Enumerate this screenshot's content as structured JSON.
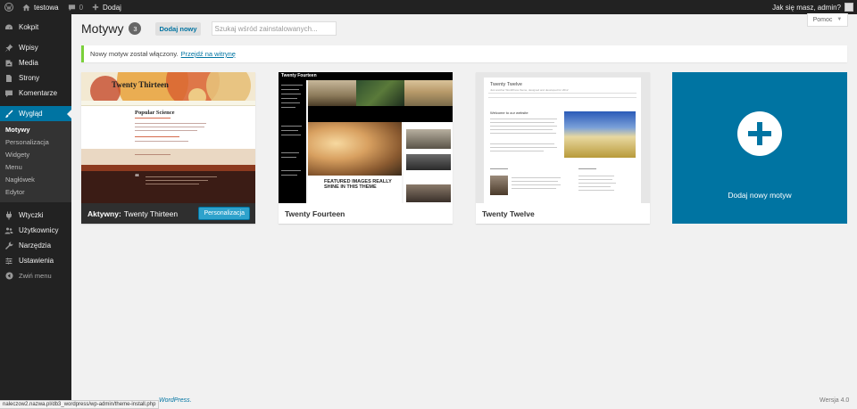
{
  "admin_bar": {
    "site_name": "testowa",
    "comments_count": "0",
    "new_label": "Dodaj",
    "howdy": "Jak się masz, admin?"
  },
  "sidebar": {
    "items": [
      {
        "label": "Kokpit",
        "icon": "dashboard-icon"
      },
      {
        "label": "Wpisy",
        "icon": "pin-icon"
      },
      {
        "label": "Media",
        "icon": "media-icon"
      },
      {
        "label": "Strony",
        "icon": "page-icon"
      },
      {
        "label": "Komentarze",
        "icon": "comment-icon"
      },
      {
        "label": "Wygląd",
        "icon": "paintbrush-icon"
      },
      {
        "label": "Wtyczki",
        "icon": "plugin-icon"
      },
      {
        "label": "Użytkownicy",
        "icon": "users-icon"
      },
      {
        "label": "Narzędzia",
        "icon": "tools-icon"
      },
      {
        "label": "Ustawienia",
        "icon": "settings-icon"
      },
      {
        "label": "Zwiń menu",
        "icon": "collapse-icon"
      }
    ],
    "submenu": [
      "Motywy",
      "Personalizacja",
      "Widgety",
      "Menu",
      "Nagłówek",
      "Edytor"
    ]
  },
  "help": {
    "label": "Pomoc"
  },
  "header": {
    "title": "Motywy",
    "count": "3",
    "add_new": "Dodaj nowy",
    "search_placeholder": "Szukaj wśród zainstalowanych..."
  },
  "notice": {
    "text": "Nowy motyw został włączony.",
    "link": "Przejdź na witrynę"
  },
  "themes": [
    {
      "name": "Twenty Thirteen",
      "active_label": "Aktywny:",
      "customize": "Personalizacja",
      "shot_title": "Twenty Thirteen",
      "shot_post": "Popular Science"
    },
    {
      "name": "Twenty Fourteen",
      "shot_logo": "Twenty Fourteen",
      "shot_feature": "FEATURED IMAGES REALLY SHINE IN THIS THEME"
    },
    {
      "name": "Twenty Twelve",
      "shot_title": "Twenty Twelve",
      "shot_tagline": "Just another WordPress theme, designed and developed for 2012",
      "shot_welcome": "Welcome to our website"
    }
  ],
  "add_theme": {
    "label": "Dodaj nowy motyw"
  },
  "footer": {
    "thanks_link": "WordPress.",
    "version": "Wersja 4.0"
  },
  "statusbar": {
    "url": "naleczow2.nazwa.pl/db3_wordpress/wp-admin/theme-install.php"
  },
  "colors": {
    "accent": "#0074a2",
    "button": "#2ea2cc",
    "notice": "#7ad03a",
    "sidebar": "#222222"
  }
}
